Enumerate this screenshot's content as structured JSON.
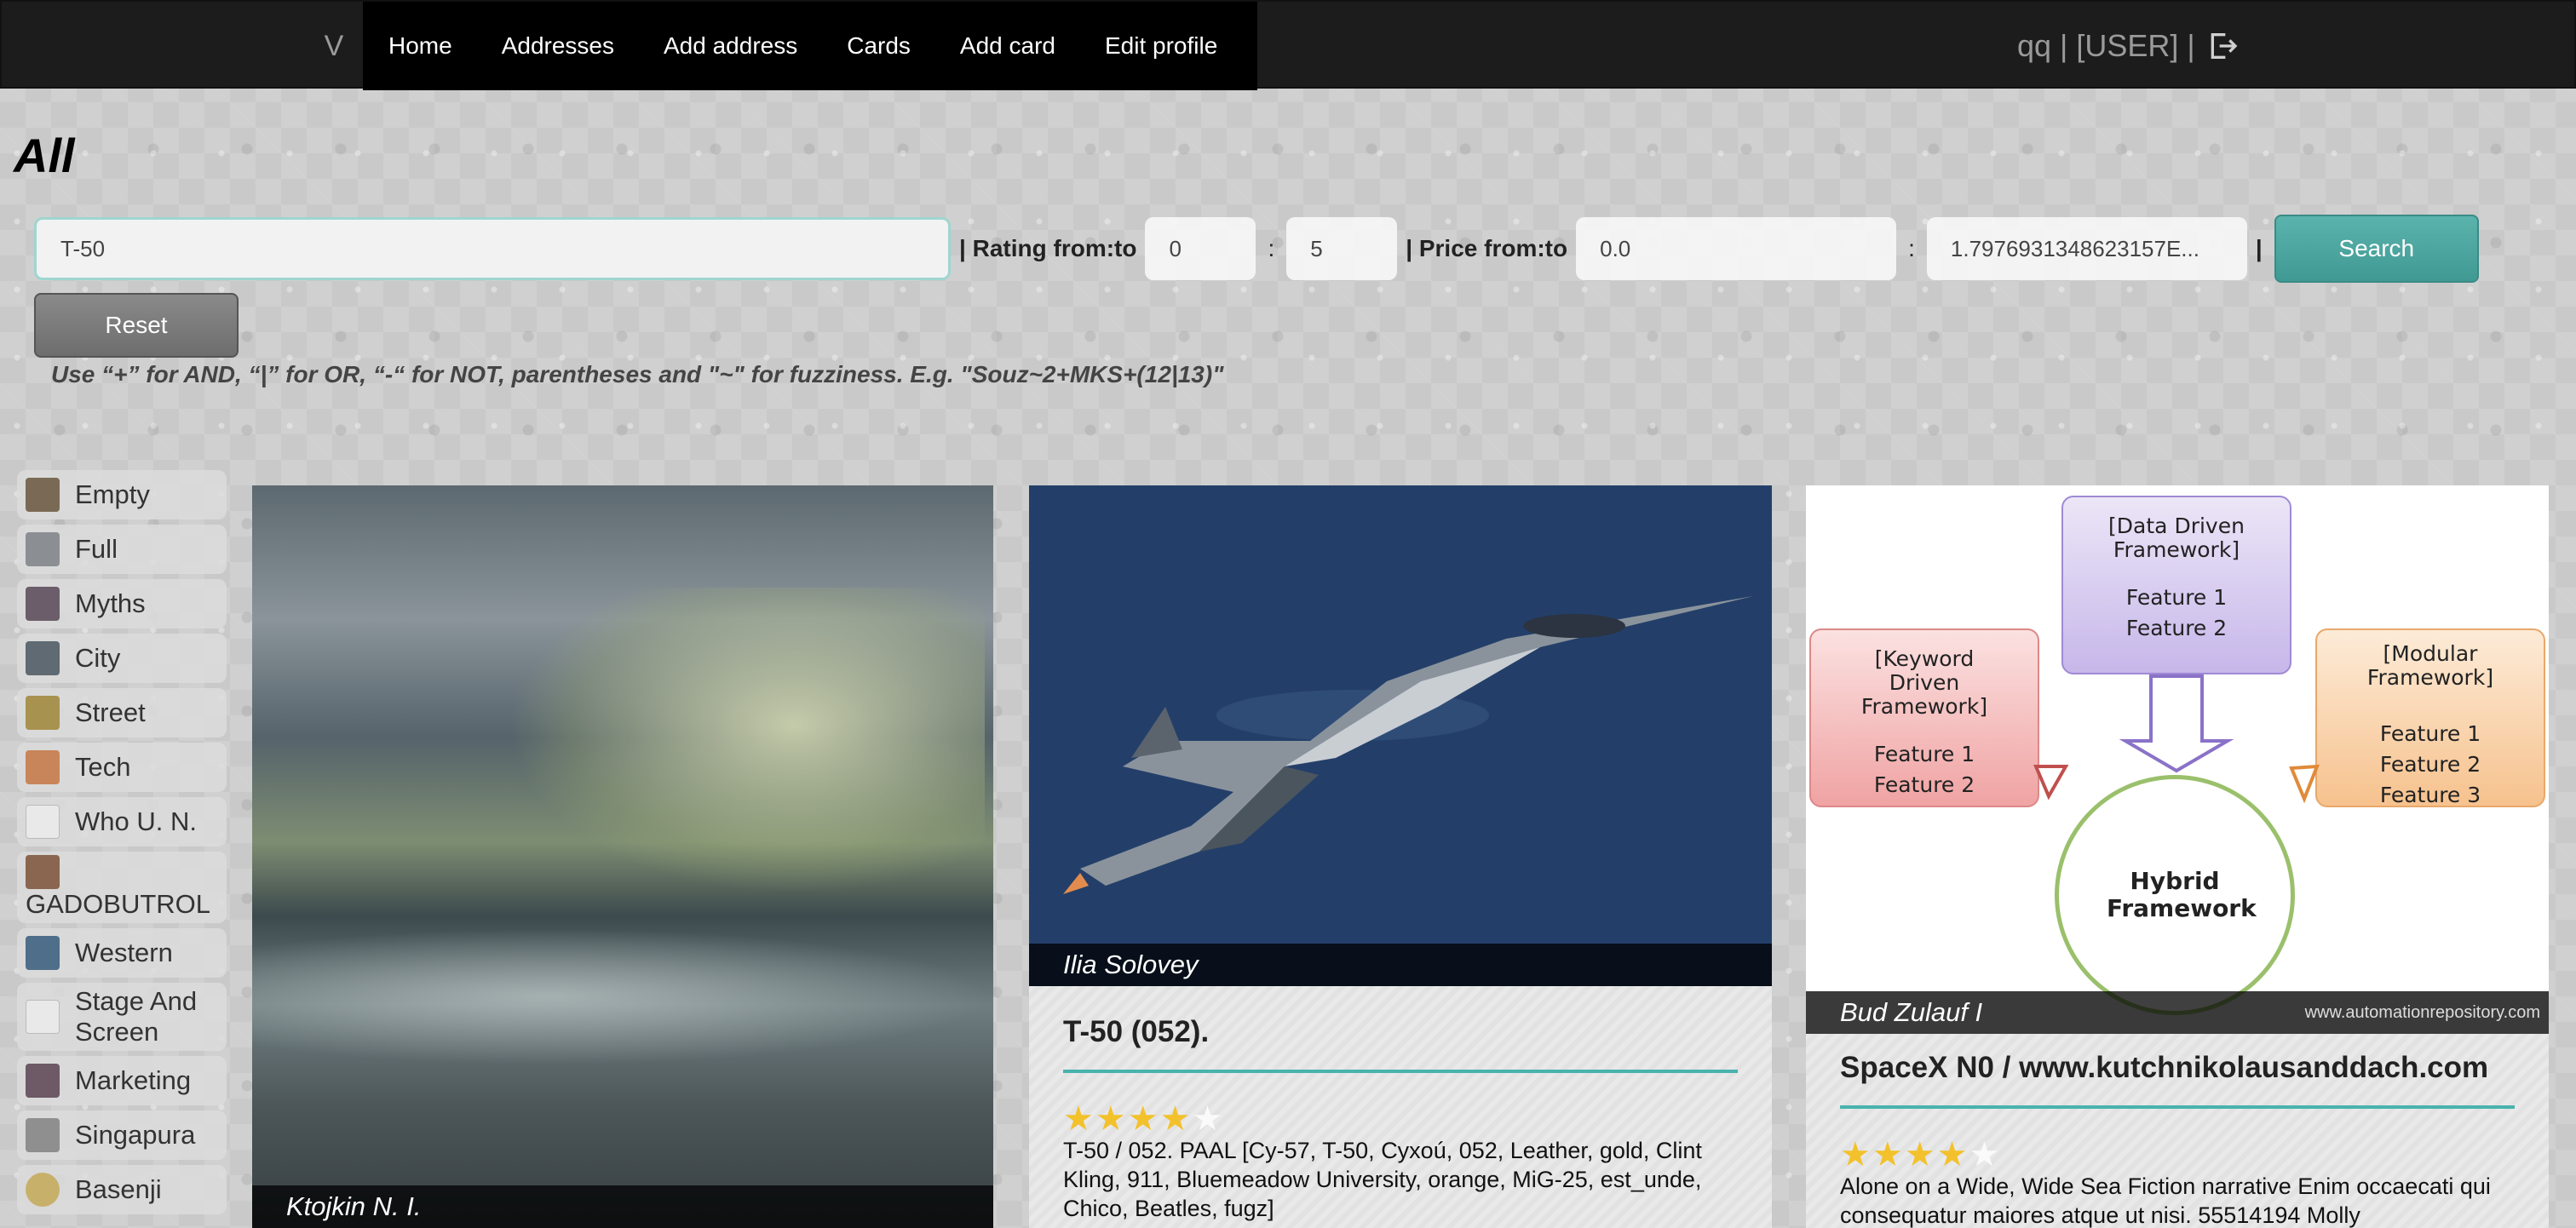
{
  "nav": {
    "brand": "V",
    "items": [
      "Home",
      "Addresses",
      "Add address",
      "Cards",
      "Add card",
      "Edit profile"
    ],
    "user_text": "qq | [USER] |",
    "logout_icon": "logout-icon"
  },
  "page": {
    "title": "All"
  },
  "search": {
    "query": "T-50",
    "rating_label": "| Rating from:to",
    "rating_from": "0",
    "rating_to": "5",
    "price_label": "| Price from:to",
    "price_from": "0.0",
    "price_to": "1.7976931348623157E...",
    "colon": ":",
    "pipe": "|",
    "search_button": "Search",
    "reset_button": "Reset",
    "hint": "Use “+” for AND, “|” for OR, “-“ for NOT, parentheses and \"~\" for fuzziness. E.g. \"Souz~2+MKS+(12|13)\""
  },
  "categories": [
    {
      "label": "Empty",
      "thumb": "#7a6a55"
    },
    {
      "label": "Full",
      "thumb": "#8b8f94"
    },
    {
      "label": "Myths",
      "thumb": "#6b5e6a"
    },
    {
      "label": "City",
      "thumb": "#5f6a72"
    },
    {
      "label": "Street",
      "thumb": "#a89250"
    },
    {
      "label": "Tech",
      "thumb": "#c9855a"
    },
    {
      "label": "Who U. N.",
      "thumb": "#e9e9e9"
    },
    {
      "label": "GADOBUTROL",
      "thumb": "#8a6650"
    },
    {
      "label": "Western",
      "thumb": "#4f6e8a"
    },
    {
      "label": "Stage And Screen",
      "thumb": "#e9e9e9"
    },
    {
      "label": "Marketing",
      "thumb": "#6d5a66"
    },
    {
      "label": "Singapura",
      "thumb": "#8f8f8f"
    },
    {
      "label": "Basenji",
      "thumb": "#c7b06a"
    }
  ],
  "cards": [
    {
      "author": "Ktojkin N. I."
    },
    {
      "author": "Ilia Solovey",
      "title": "T-50 (052).",
      "rating": 4,
      "desc": "T-50 / 052. PAAL [Cy-57, T-50, Cyxoú, 052, Leather, gold, Clint Kling, 911, Bluemeadow University, orange, MiG-25, est_unde, Chico, Beatles, fugz]"
    },
    {
      "author": "Bud Zulauf I",
      "watermark": "www.automationrepository.com",
      "title": "SpaceX N0 / www.kutchnikolausanddach.com",
      "rating": 4,
      "desc": "Alone on a Wide, Wide Sea Fiction narrative Enim occaecati qui consequatur maiores atque ut nisi. 55514194 Molly",
      "diagram": {
        "top": "[Data Driven Framework]",
        "top_features": [
          "Feature 1",
          "Feature 2"
        ],
        "left": "[Keyword Driven Framework]",
        "left_features": [
          "Feature 1",
          "Feature 2"
        ],
        "right": "[Modular Framework]",
        "right_features": [
          "Feature 1",
          "Feature 2",
          "Feature 3"
        ],
        "center": "Hybrid Framework"
      }
    }
  ],
  "colors": {
    "accent": "#48b3ad",
    "star": "#f3c12b",
    "nav_bg": "#1c1c1c"
  }
}
